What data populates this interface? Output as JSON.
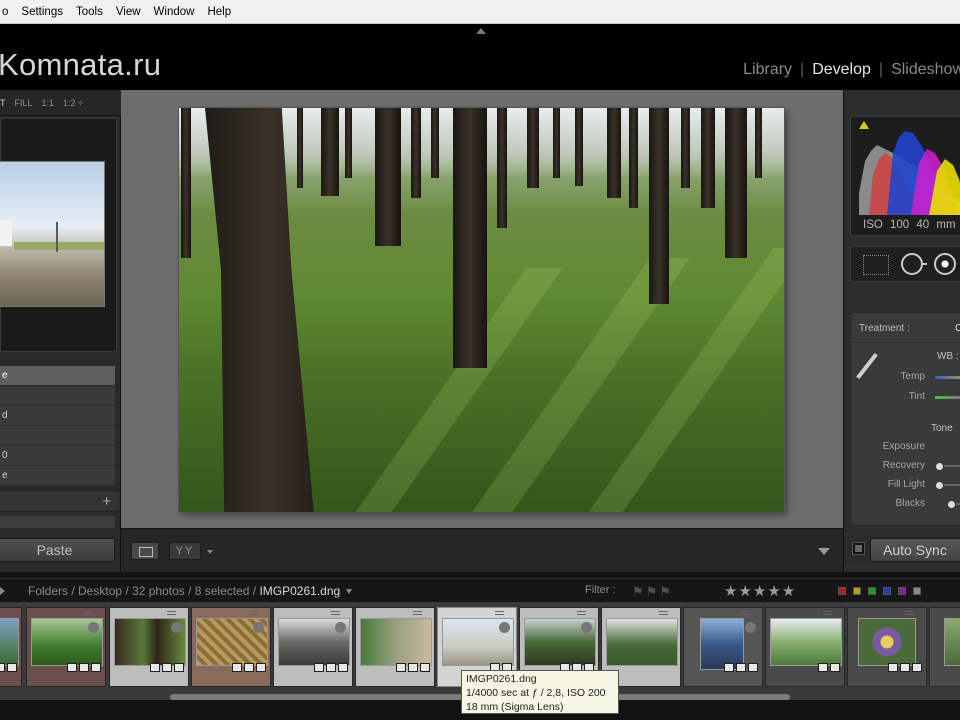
{
  "menubar": {
    "items": [
      "o",
      "Settings",
      "Tools",
      "View",
      "Window",
      "Help"
    ]
  },
  "identity_plate": "Komnata.ru",
  "modules": {
    "library": "Library",
    "develop": "Develop",
    "slideshow": "Slideshow",
    "separator": "|"
  },
  "navigator": {
    "zoom_options": [
      "T",
      "FILL",
      "1:1",
      "1:2 ÷"
    ]
  },
  "presets": {
    "items": [
      "e",
      "",
      "d",
      "",
      "0",
      "e"
    ]
  },
  "left_panel": {
    "paste_label": "Paste"
  },
  "toolbar": {
    "compare_label": "YY"
  },
  "histogram": {
    "info": "ISO 100  40 mm"
  },
  "basic": {
    "treatment_label": "Treatment :",
    "treatment_value": "C",
    "wb_label": "WB :",
    "temp_label": "Temp",
    "tint_label": "Tint",
    "tone_label": "Tone",
    "exposure_label": "Exposure",
    "recovery_label": "Recovery",
    "fill_light_label": "Fill Light",
    "blacks_label": "Blacks"
  },
  "right_panel": {
    "autosync_label": "Auto Sync"
  },
  "filmstrip_header": {
    "path": "Folders / Desktop / 32 photos / 8 selected / ",
    "filename": "IMGP0261.dng",
    "filter_label": "Filter :",
    "stars": "★★★★★",
    "flags": "⚑⚑⚑",
    "chip_colors": [
      "#b02020",
      "#b0a020",
      "#20a020",
      "#2040b0",
      "#8020a0",
      "#8a8a8a"
    ]
  },
  "tooltip": {
    "line1": "IMGP0261.dng",
    "line2": "1/4000 sec at ƒ / 2,8, ISO 200",
    "line3": "18 mm (Sigma Lens)"
  }
}
